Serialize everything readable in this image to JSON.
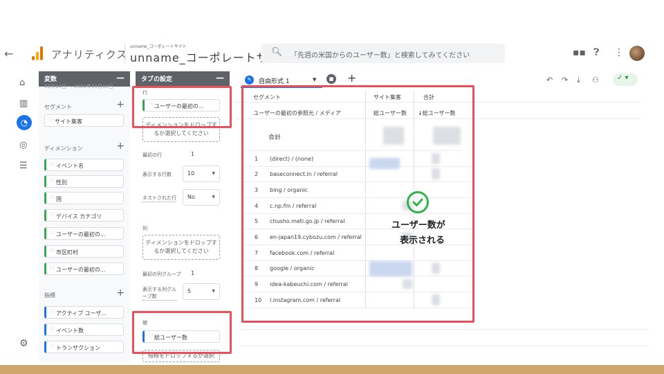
{
  "header": {
    "app_name": "アナリティクス",
    "property_account": "unname_コーポレートサイト",
    "property_name": "unname_コーポレートサイト",
    "search_placeholder": "「先週の米国からのユーザー数」と検索してみてください"
  },
  "variables_panel": {
    "title": "変数",
    "date_fragment": "10月14日 ～ 2022年11月10日",
    "segments_title": "セグメント",
    "segments": [
      "サイト集客"
    ],
    "dimensions_title": "ディメンション",
    "dimensions": [
      "イベント名",
      "性別",
      "国",
      "デバイス カテゴリ",
      "ユーザーの最初の...",
      "市区町村",
      "ユーザーの最初の..."
    ],
    "metrics_title": "指標",
    "metrics": [
      "アクティブ ユーザ...",
      "イベント数",
      "トランザクション"
    ]
  },
  "tab_settings": {
    "title": "タブの設定",
    "rows_label": "行",
    "rows_chip": "ユーザーの最初の...",
    "rows_drop": "ディメンションをドロップするか選択してください",
    "first_row_label": "最初の行",
    "first_row_value": "1",
    "show_rows_label": "表示する行数",
    "show_rows_value": "10",
    "nested_label": "ネストされた行",
    "nested_value": "No",
    "columns_label": "列",
    "columns_drop": "ディメンションをドロップするか選択してください",
    "first_col_group_label": "最初の列グループ",
    "first_col_group_value": "1",
    "show_col_groups_label": "表示する列グループ数",
    "show_col_groups_value": "5",
    "values_label": "値",
    "values_chip": "総ユーザー数",
    "values_drop": "指標をドロップするか選択"
  },
  "canvas": {
    "tab_name": "自由形式 1",
    "table": {
      "header_segment": "セグメント",
      "header_site": "サイト集客",
      "header_total": "合計",
      "dimension_header": "ユーザーの最初の参照元 / メディア",
      "metric_header_1": "総ユーザー数",
      "metric_header_2": "↓総ユーザー数",
      "total_label": "合計",
      "rows": [
        {
          "num": "1",
          "source": "(direct) / (none)"
        },
        {
          "num": "2",
          "source": "baseconnect.in / referral"
        },
        {
          "num": "3",
          "source": "bing / organic"
        },
        {
          "num": "4",
          "source": "c.np.fm / referral"
        },
        {
          "num": "5",
          "source": "chusho.meti.go.jp / referral"
        },
        {
          "num": "6",
          "source": "en-japan19.cybozu.com / referral"
        },
        {
          "num": "7",
          "source": "facebook.com / referral"
        },
        {
          "num": "8",
          "source": "google / organic"
        },
        {
          "num": "9",
          "source": "idea-kabeuchi.com / referral"
        },
        {
          "num": "10",
          "source": "l.instagram.com / referral"
        }
      ]
    },
    "annotation_line1": "ユーザー数が",
    "annotation_line2": "表示される"
  },
  "colors": {
    "accent": "#1a73e8",
    "highlight": "#e8505b",
    "success": "#2db34a"
  }
}
